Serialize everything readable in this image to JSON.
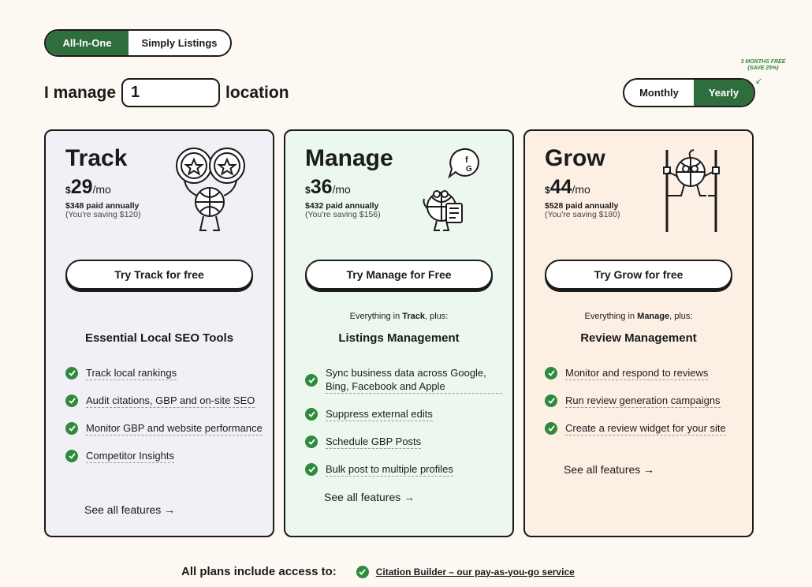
{
  "plan_type": {
    "options": [
      "All-In-One",
      "Simply Listings"
    ],
    "selected": "All-In-One"
  },
  "manage": {
    "prefix": "I manage",
    "value": "1",
    "suffix": "location"
  },
  "billing": {
    "options": [
      "Monthly",
      "Yearly"
    ],
    "selected": "Yearly",
    "promo_line1": "3 MONTHS FREE",
    "promo_line2": "(SAVE 25%)"
  },
  "colors": {
    "accent": "#2f6d3d",
    "check": "#2f8a3e",
    "track_bg": "#f1f0f7",
    "manage_bg": "#ecf8ee",
    "grow_bg": "#fcf0e4"
  },
  "plans": [
    {
      "name": "Track",
      "currency": "$",
      "price": "29",
      "per": "/mo",
      "annual": "$348 paid annually",
      "saving": "(You're saving $120)",
      "cta": "Try Track for free",
      "everything_pre": "",
      "everything_plan": "",
      "everything_post": "",
      "section": "Essential Local SEO Tools",
      "features": [
        "Track local rankings",
        "Audit citations, GBP and on-site SEO",
        "Monitor GBP and website performance",
        "Competitor Insights"
      ],
      "see_all": "See all features →",
      "icon": "binoculars-stars-icon"
    },
    {
      "name": "Manage",
      "currency": "$",
      "price": "36",
      "per": "/mo",
      "annual": "$432 paid annually",
      "saving": "(You're saving $156)",
      "cta": "Try Manage for Free",
      "everything_pre": "Everything in ",
      "everything_plan": "Track",
      "everything_post": ", plus:",
      "section": "Listings Management",
      "features": [
        "Sync business data across Google, Bing, Facebook and Apple",
        "Suppress external edits",
        "Schedule GBP Posts",
        "Bulk post to multiple profiles"
      ],
      "see_all": "See all features →",
      "icon": "globe-clipboard-icon"
    },
    {
      "name": "Grow",
      "currency": "$",
      "price": "44",
      "per": "/mo",
      "annual": "$528 paid annually",
      "saving": "(You're saving $180)",
      "cta": "Try Grow for free",
      "everything_pre": "Everything in ",
      "everything_plan": "Manage",
      "everything_post": ", plus:",
      "section": "Review Management",
      "features": [
        "Monitor and respond to reviews",
        "Run review generation campaigns",
        "Create a review widget for your site"
      ],
      "see_all": "See all features →",
      "icon": "globe-stilts-icon"
    }
  ],
  "footer": {
    "label": "All plans include access to:",
    "link": "Citation Builder – our pay-as-you-go service"
  }
}
